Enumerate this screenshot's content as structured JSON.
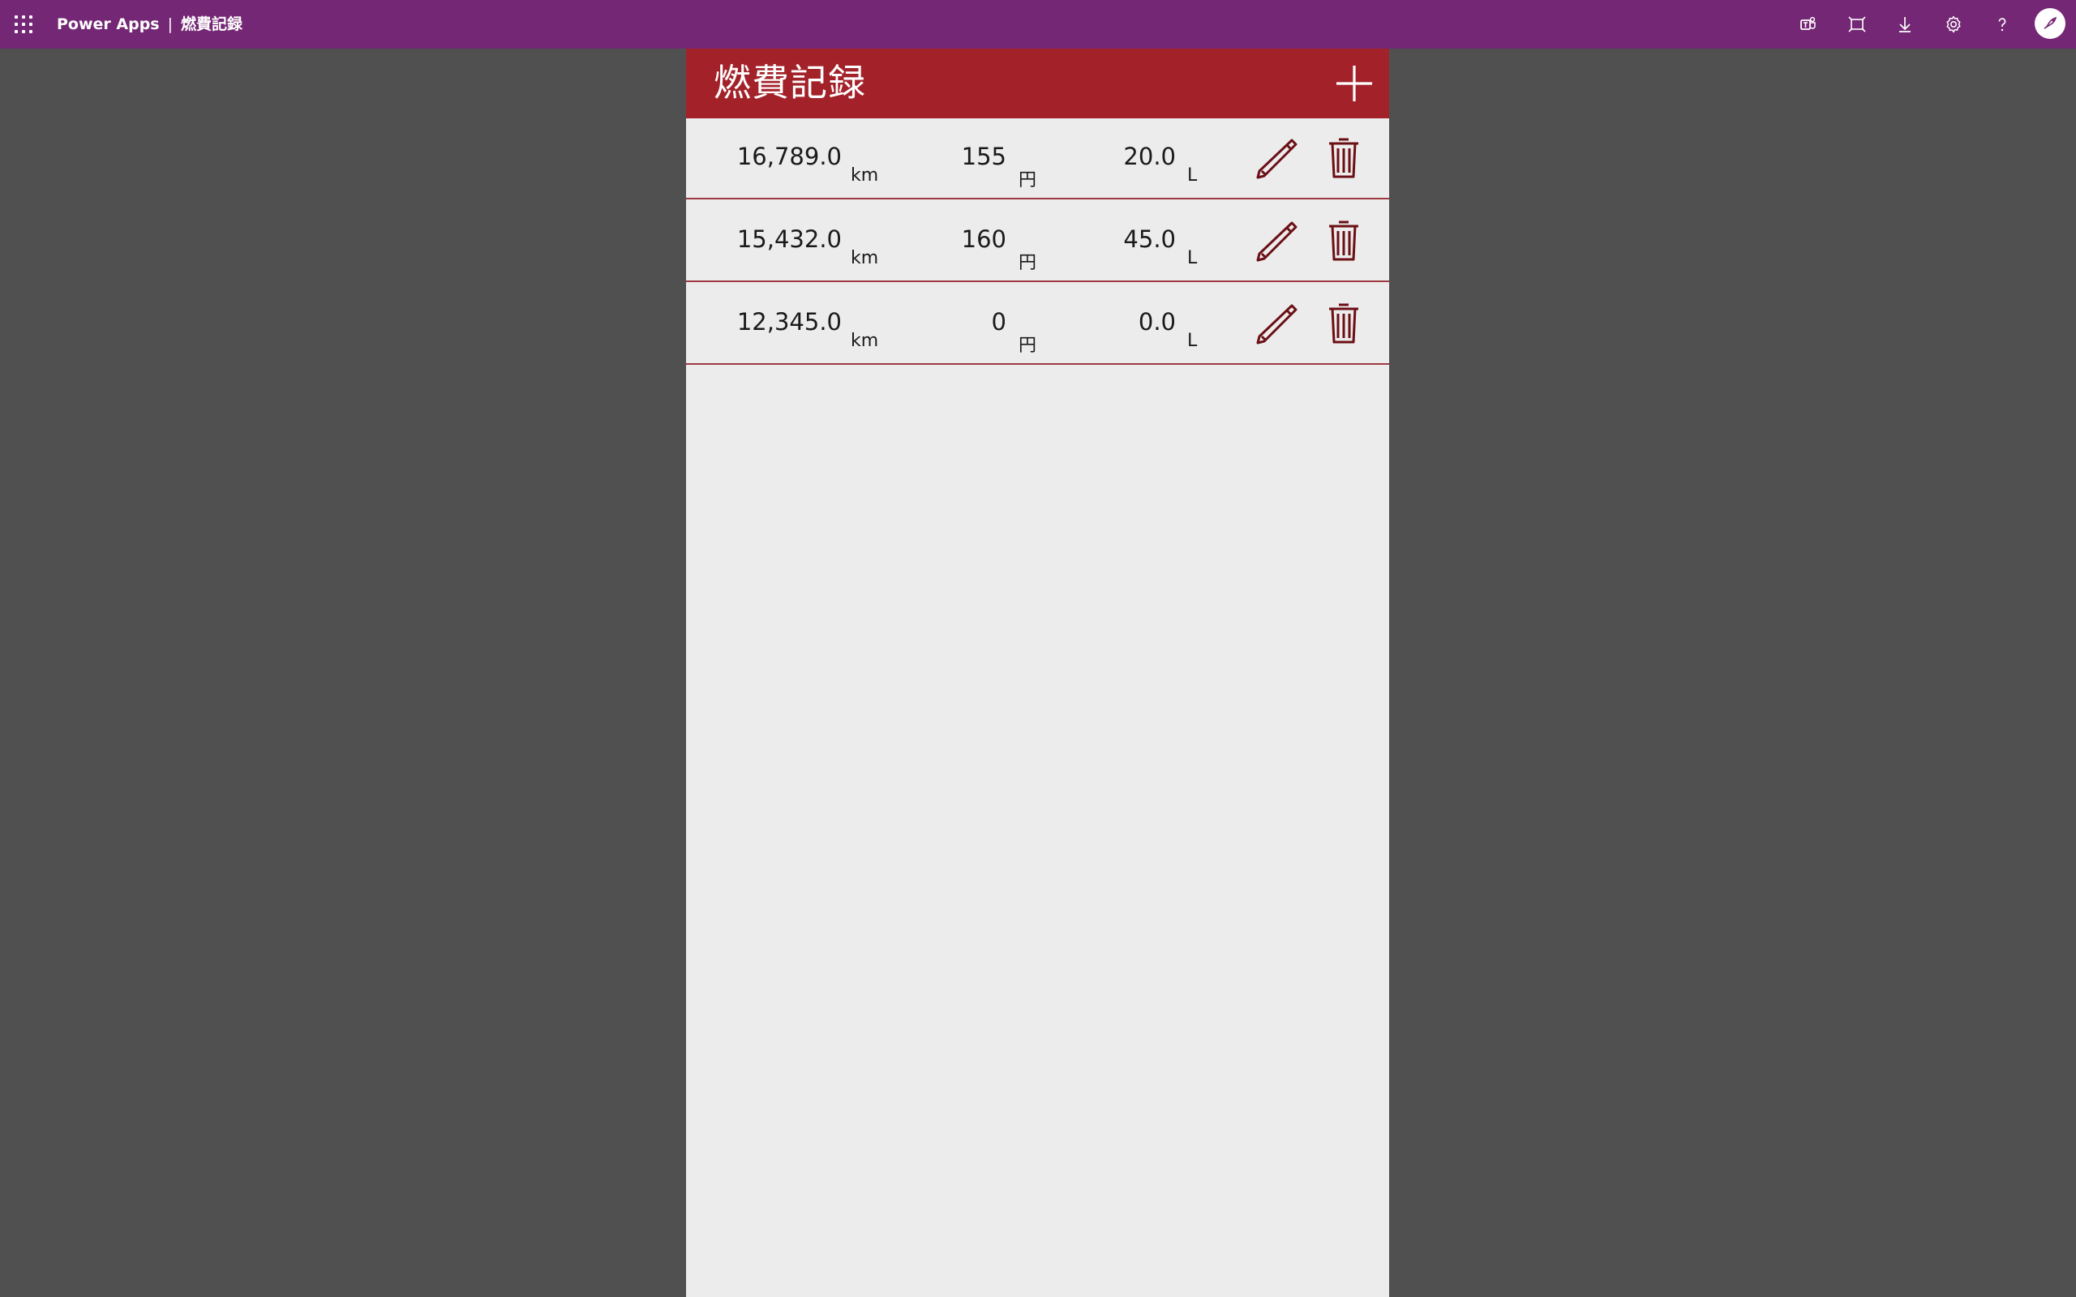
{
  "topbar": {
    "product": "Power Apps",
    "separator": "|",
    "app_name": "燃費記録",
    "background": "#742774",
    "icons": [
      "teams-icon",
      "fit-to-window-icon",
      "download-icon",
      "settings-icon",
      "help-icon",
      "avatar-icon"
    ]
  },
  "app": {
    "title": "燃費記録",
    "header_color": "#a3222a",
    "icon_color": "#6b0f15",
    "add_icon": "plus-icon",
    "records": [
      {
        "odometer": "16,789.0",
        "odometer_unit": "km",
        "price": "155",
        "price_unit": "円",
        "fuel": "20.0",
        "fuel_unit": "L",
        "edit_icon": "pencil-icon",
        "delete_icon": "trash-icon"
      },
      {
        "odometer": "15,432.0",
        "odometer_unit": "km",
        "price": "160",
        "price_unit": "円",
        "fuel": "45.0",
        "fuel_unit": "L",
        "edit_icon": "pencil-icon",
        "delete_icon": "trash-icon"
      },
      {
        "odometer": "12,345.0",
        "odometer_unit": "km",
        "price": "0",
        "price_unit": "円",
        "fuel": "0.0",
        "fuel_unit": "L",
        "edit_icon": "pencil-icon",
        "delete_icon": "trash-icon"
      }
    ]
  }
}
